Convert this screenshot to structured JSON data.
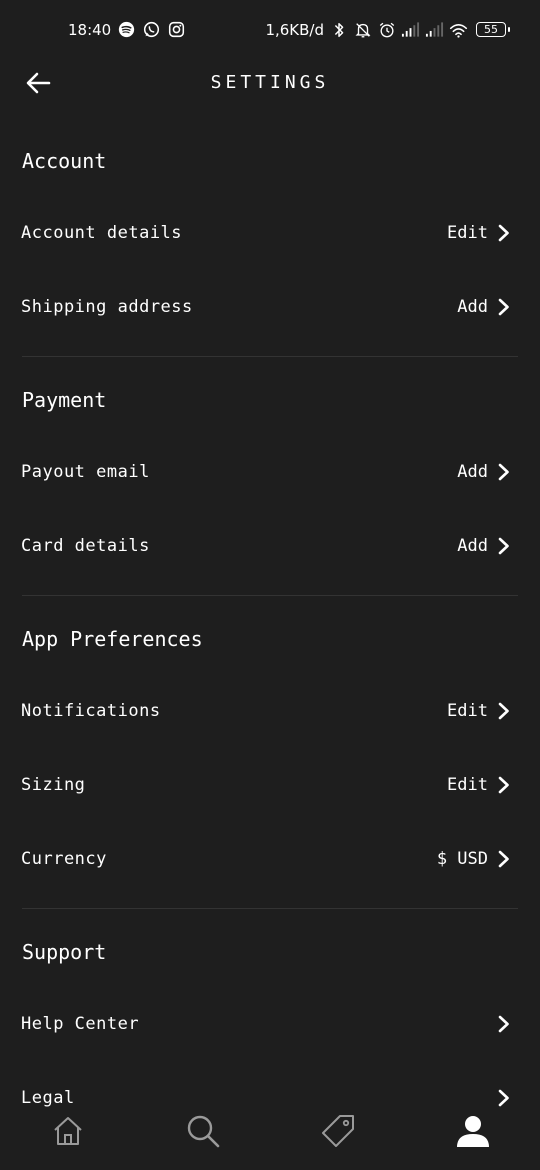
{
  "status_bar": {
    "time": "18:40",
    "net_speed": "1,6KB/d",
    "battery": "55",
    "icons_left": [
      "spotify-icon",
      "whatsapp-icon",
      "instagram-icon"
    ],
    "icons_right": [
      "bluetooth-icon",
      "muted-bell-icon",
      "alarm-icon",
      "signal-icon",
      "signal-icon",
      "wifi-icon",
      "battery-icon"
    ]
  },
  "header": {
    "title": "SETTINGS",
    "back_icon": "arrow-left-icon"
  },
  "sections": [
    {
      "title": "Account",
      "rows": [
        {
          "label": "Account details",
          "action": "Edit"
        },
        {
          "label": "Shipping address",
          "action": "Add"
        }
      ]
    },
    {
      "title": "Payment",
      "rows": [
        {
          "label": "Payout email",
          "action": "Add"
        },
        {
          "label": "Card details",
          "action": "Add"
        }
      ]
    },
    {
      "title": "App Preferences",
      "rows": [
        {
          "label": "Notifications",
          "action": "Edit"
        },
        {
          "label": "Sizing",
          "action": "Edit"
        },
        {
          "label": "Currency",
          "action": "$ USD"
        }
      ]
    },
    {
      "title": "Support",
      "rows": [
        {
          "label": "Help Center",
          "action": ""
        },
        {
          "label": "Legal",
          "action": ""
        }
      ]
    }
  ],
  "bottom_nav": {
    "items": [
      "home-icon",
      "search-icon",
      "tag-icon",
      "profile-icon"
    ],
    "active": "profile-icon"
  },
  "colors": {
    "background": "#1e1e1e",
    "text": "#ffffff",
    "divider": "#333333"
  }
}
